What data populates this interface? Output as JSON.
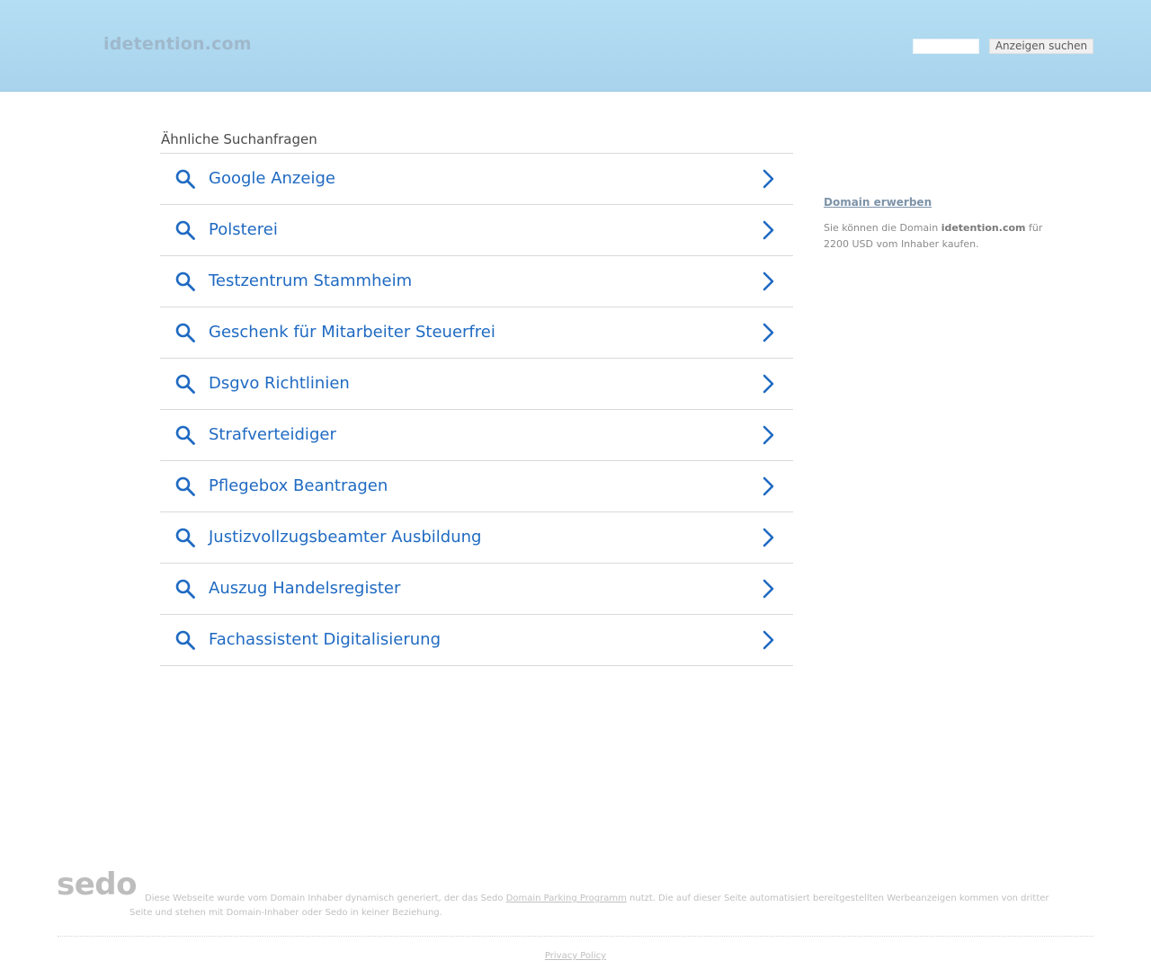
{
  "header": {
    "domain_title": "idetention.com",
    "search_placeholder": "",
    "search_button_label": "Anzeigen suchen"
  },
  "related_searches": {
    "heading": "Ähnliche Suchanfragen",
    "items": [
      {
        "label": "Google Anzeige"
      },
      {
        "label": "Polsterei"
      },
      {
        "label": "Testzentrum Stammheim"
      },
      {
        "label": "Geschenk für Mitarbeiter Steuerfrei"
      },
      {
        "label": "Dsgvo Richtlinien"
      },
      {
        "label": "Strafverteidiger"
      },
      {
        "label": "Pflegebox Beantragen"
      },
      {
        "label": "Justizvollzugsbeamter Ausbildung"
      },
      {
        "label": "Auszug Handelsregister"
      },
      {
        "label": "Fachassistent Digitalisierung"
      }
    ]
  },
  "sidebar": {
    "title": "Domain erwerben",
    "text_before": "Sie können die Domain ",
    "domain": "idetention.com",
    "text_after": " für 2200 USD vom Inhaber kaufen."
  },
  "footer": {
    "logo_text": "sedo",
    "disclaimer_before": "Diese Webseite wurde vom Domain Inhaber dynamisch generiert, der das Sedo ",
    "disclaimer_link": "Domain Parking Programm",
    "disclaimer_after": " nutzt. Die auf dieser Seite automatisiert bereitgestellten Werbeanzeigen kommen von dritter Seite und stehen mit Domain-Inhaber oder Sedo in keiner Beziehung.",
    "privacy_link": "Privacy Policy"
  },
  "colors": {
    "link_blue": "#1f6ac2",
    "header_top": "#b3def3",
    "header_bottom": "#a9d3ec"
  },
  "icons": {
    "item_left": "search-icon",
    "item_right": "chevron-right-icon"
  }
}
